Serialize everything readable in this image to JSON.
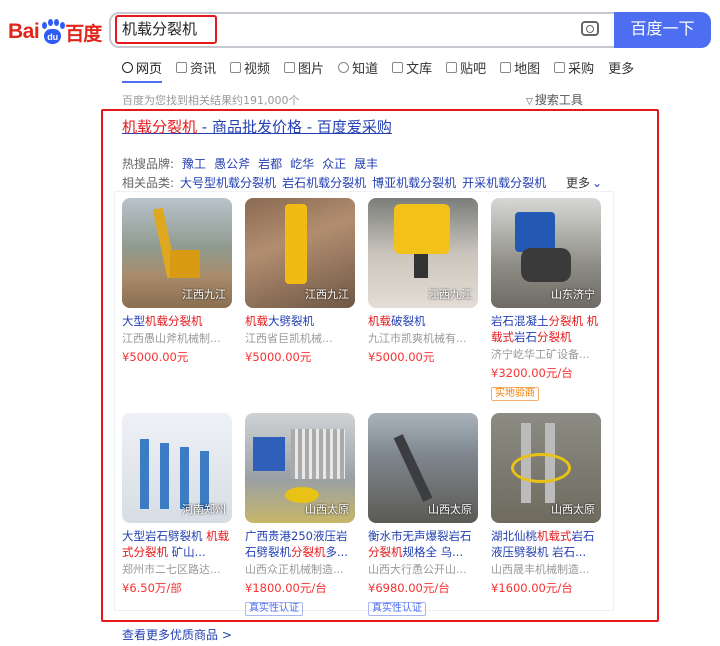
{
  "logo": {
    "bai": "Bai",
    "du": "du",
    "cn": "百度"
  },
  "search": {
    "query": "机载分裂机",
    "button": "百度一下"
  },
  "tabs": [
    {
      "label": "网页",
      "icon": "search-icon"
    },
    {
      "label": "资讯",
      "icon": "news-icon"
    },
    {
      "label": "视频",
      "icon": "video-icon"
    },
    {
      "label": "图片",
      "icon": "image-icon"
    },
    {
      "label": "知道",
      "icon": "question-icon"
    },
    {
      "label": "文库",
      "icon": "document-icon"
    },
    {
      "label": "贴吧",
      "icon": "forum-icon"
    },
    {
      "label": "地图",
      "icon": "map-icon"
    },
    {
      "label": "采购",
      "icon": "cart-icon"
    },
    {
      "label": "更多",
      "icon": ""
    }
  ],
  "results": {
    "count": "百度为您找到相关结果约191,000个",
    "tools": "搜索工具"
  },
  "ad": {
    "title_hl": "机载分裂机",
    "title_rest": " - 商品批发价格 - 百度爱采购",
    "brand_label": "热搜品牌:",
    "brands": [
      "豫工",
      "愚公斧",
      "岩都",
      "屹华",
      "众正",
      "晟丰"
    ],
    "cat_label": "相关品类:",
    "cats": [
      "大号型机载分裂机",
      "岩石机载分裂机",
      "博亚机载分裂机",
      "开采机载分裂机"
    ],
    "more": "更多",
    "products": [
      {
        "name": "大型机载分裂机",
        "company": "江西愚山斧机械制...",
        "price": "¥5000.00元",
        "location": "江西九江",
        "badge": ""
      },
      {
        "name": "机载大劈裂机",
        "company": "江西省巨凯机械...",
        "price": "¥5000.00元",
        "location": "江西九江",
        "badge": ""
      },
      {
        "name": "机载破裂机",
        "company": "九江市凯爽机械有...",
        "price": "¥5000.00元",
        "location": "江西九江",
        "badge": ""
      },
      {
        "name": "岩石混凝土分裂机 机载式岩石分裂机",
        "company": "济宁屹华工矿设备...",
        "price": "¥3200.00元/台",
        "location": "山东济宁",
        "badge": "实地验商"
      },
      {
        "name": "大型岩石劈裂机 机载式分裂机 矿山...",
        "company": "郑州市二七区路达...",
        "price": "¥6.50万/部",
        "location": "河南郑州",
        "badge": ""
      },
      {
        "name": "广西贵港250液压岩石劈裂机分裂机多...",
        "company": "山西众正机械制造...",
        "price": "¥1800.00元/台",
        "location": "山西太原",
        "badge": "真实性认证"
      },
      {
        "name": "衡水市无声爆裂岩石分裂机规格全 乌...",
        "company": "山西大行恿公开山...",
        "price": "¥6980.00元/台",
        "location": "山西太原",
        "badge": "真实性认证"
      },
      {
        "name": "湖北仙桃机载式岩石液压劈裂机 岩石...",
        "company": "山西晟丰机械制造...",
        "price": "¥1600.00元/台",
        "location": "山西太原",
        "badge": ""
      }
    ],
    "footer": "查看更多优质商品 >"
  },
  "colors": {
    "accent": "#4e6ef2",
    "link": "#2440b3",
    "highlight": "#e5191c",
    "price": "#f73131"
  }
}
